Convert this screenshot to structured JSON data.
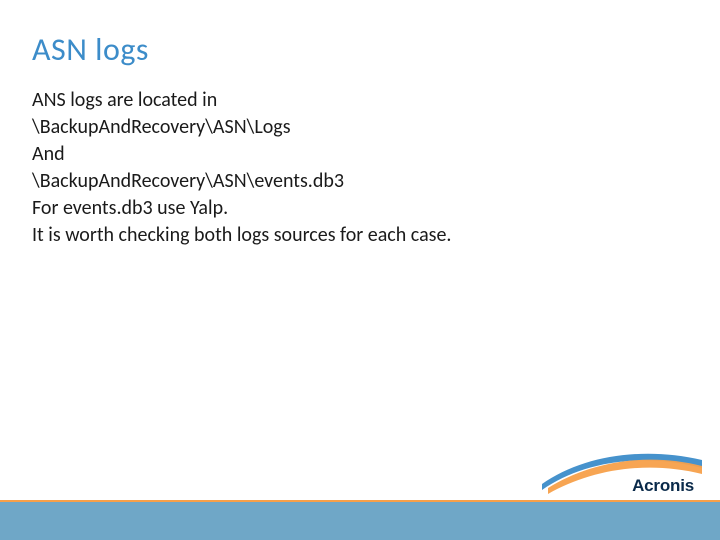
{
  "title": "ASN logs",
  "body": {
    "line1": "ANS logs are located in",
    "line2": "\\BackupAndRecovery\\ASN\\Logs",
    "line3": "And",
    "line4": "\\BackupAndRecovery\\ASN\\events.db3",
    "line5": "For events.db3 use Yalp.",
    "line6": "It is worth checking both logs sources for each case."
  },
  "brand": "Acronis",
  "colors": {
    "title": "#3c8cc9",
    "band": "#6fa7c7",
    "accent": "#f7a04a",
    "brand": "#0a2a4a"
  }
}
